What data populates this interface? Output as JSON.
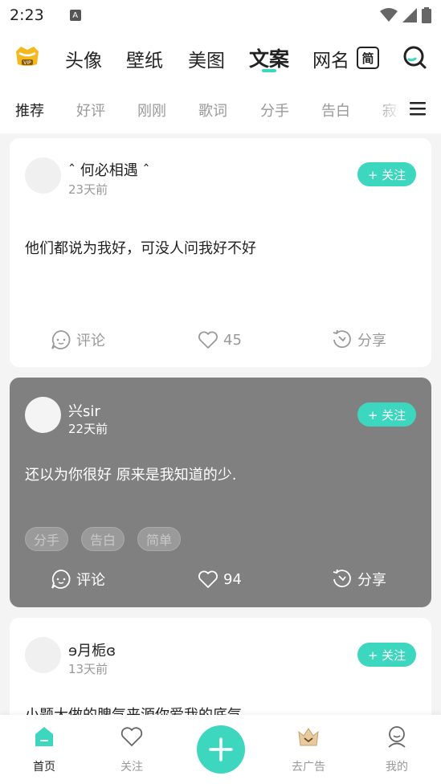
{
  "status_bar": {
    "time": "2:23",
    "notif_icon": "A"
  },
  "top_nav": {
    "tabs": [
      {
        "label": "头像"
      },
      {
        "label": "壁纸"
      },
      {
        "label": "美图"
      },
      {
        "label": "文案"
      },
      {
        "label": "网名"
      }
    ],
    "active_tab": "文案",
    "simp_label": "简",
    "vip_label": "VIP",
    "accent": "#3dd6bf"
  },
  "sub_tabs": {
    "items": [
      {
        "label": "推荐"
      },
      {
        "label": "好评"
      },
      {
        "label": "刚刚"
      },
      {
        "label": "歌词"
      },
      {
        "label": "分手"
      },
      {
        "label": "告白"
      },
      {
        "label": "寂"
      }
    ],
    "active": "推荐"
  },
  "posts": [
    {
      "username": "ˆ 何必相遇 ˆ",
      "time": "23天前",
      "follow_label": "+ 关注",
      "text": "他们都说为我好，可没人问我好不好",
      "tags": [],
      "comment_label": "评论",
      "likes": "45",
      "share_label": "分享"
    },
    {
      "username": "兴sir",
      "time": "22天前",
      "follow_label": "+ 关注",
      "text": "还以为你很好 原来是我知道的少.",
      "tags": [
        "分手",
        "告白",
        "简单"
      ],
      "comment_label": "评论",
      "likes": "94",
      "share_label": "分享"
    },
    {
      "username": "ɘ月栀ɞ",
      "time": "13天前",
      "follow_label": "+ 关注",
      "text": "小题大做的脾气来源你爱我的底气"
    }
  ],
  "bottom_nav": {
    "items": [
      {
        "label": "首页"
      },
      {
        "label": "关注"
      },
      {
        "label": "去广告"
      },
      {
        "label": "我的"
      }
    ]
  }
}
